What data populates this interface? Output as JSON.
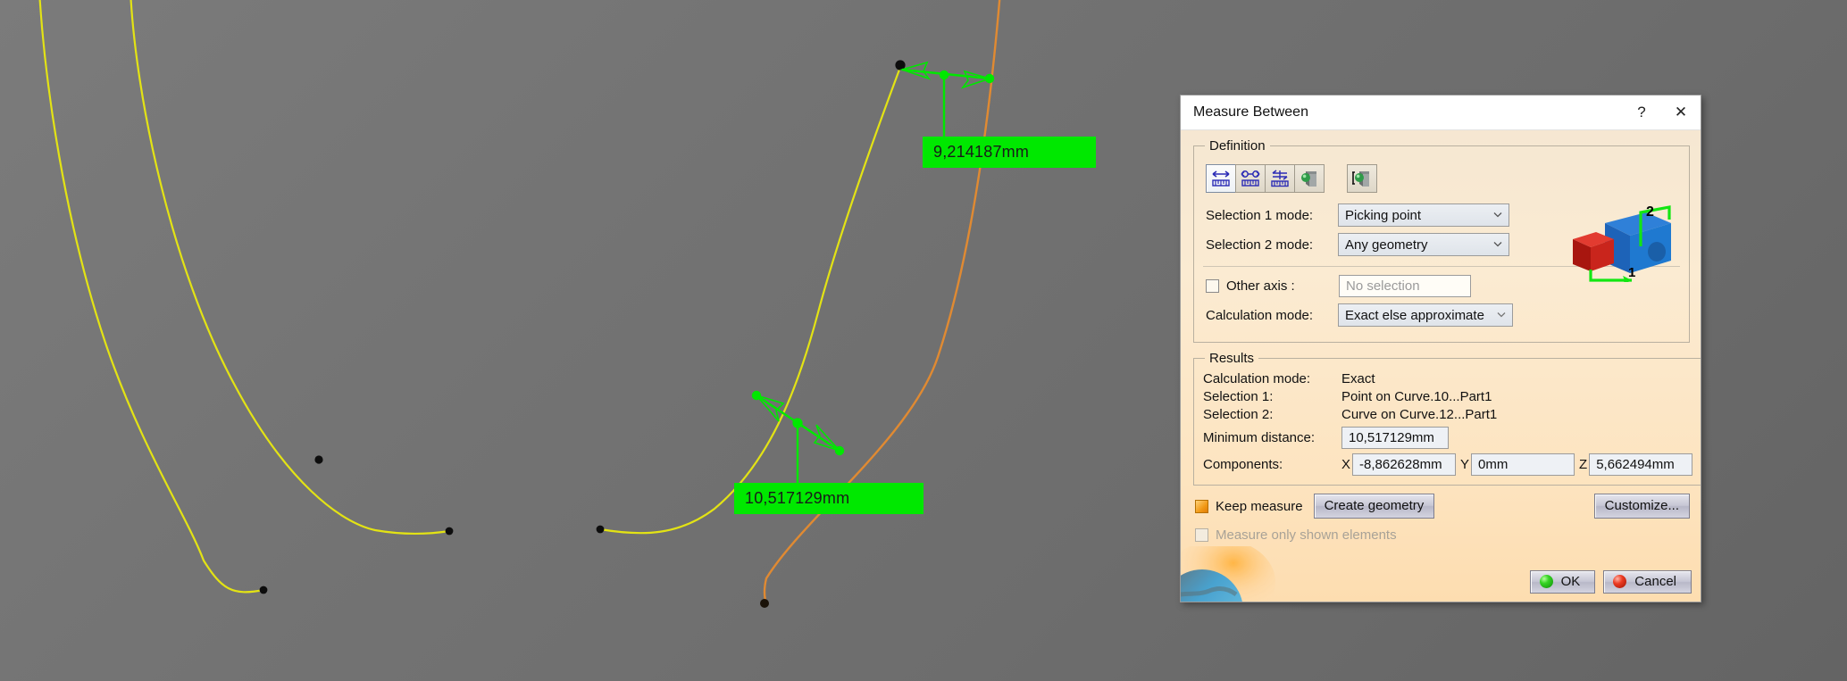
{
  "app": {
    "viewport_bg": "#6e6e6e",
    "curve_color_yellow": "#e3e314",
    "curve_color_orange": "#e08a32",
    "annotation_color": "#00e800"
  },
  "viewport": {
    "measurements": [
      {
        "id": "upper",
        "label": "9,214187mm"
      },
      {
        "id": "lower",
        "label": "10,517129mm"
      }
    ]
  },
  "dialog": {
    "title": "Measure Between",
    "help_label": "?",
    "close_label": "✕",
    "definition": {
      "legend": "Definition",
      "tools": [
        {
          "name": "measure-between-icon",
          "selected": true
        },
        {
          "name": "measure-between-two-points-icon",
          "selected": false
        },
        {
          "name": "measure-between-chain-icon",
          "selected": false
        },
        {
          "name": "measure-item-icon",
          "selected": false
        },
        {
          "name": "measure-item-other-icon",
          "selected": false
        }
      ],
      "selection1_label": "Selection 1 mode:",
      "selection1_value": "Picking point",
      "selection2_label": "Selection 2 mode:",
      "selection2_value": "Any geometry",
      "other_axis_label": "Other axis :",
      "other_axis_checked": false,
      "other_axis_value": "No selection",
      "calculation_mode_label": "Calculation mode:",
      "calculation_mode_value": "Exact else approximate",
      "preview_axis_1": "1",
      "preview_axis_2": "2"
    },
    "results": {
      "legend": "Results",
      "rows": [
        {
          "key": "Calculation mode:",
          "value": "Exact"
        },
        {
          "key": "Selection 1:",
          "value": "Point on Curve.10...Part1"
        },
        {
          "key": "Selection 2:",
          "value": "Curve on Curve.12...Part1"
        }
      ],
      "minimum_distance_label": "Minimum distance:",
      "minimum_distance_value": "10,517129mm",
      "components_label": "Components:",
      "components": [
        {
          "axis": "X",
          "value": "-8,862628mm"
        },
        {
          "axis": "Y",
          "value": "0mm"
        },
        {
          "axis": "Z",
          "value": "5,662494mm"
        }
      ]
    },
    "footer": {
      "keep_measure_label": "Keep measure",
      "keep_measure_checked": true,
      "create_geometry_label": "Create geometry",
      "customize_label": "Customize...",
      "measure_only_shown_label": "Measure only shown elements",
      "measure_only_shown_checked": false,
      "ok_label": "OK",
      "cancel_label": "Cancel"
    }
  }
}
